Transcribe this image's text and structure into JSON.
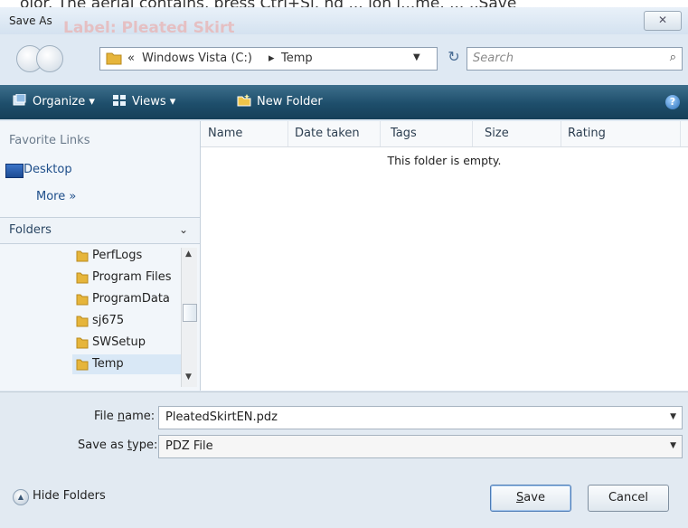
{
  "window": {
    "title": "Save As",
    "ghost_label": "Label: Pleated Skirt",
    "close_glyph": "✕"
  },
  "top_snippet": "olor. The aerial contains, press Ctrl+Sl, nd ... ion l...me. ... ,,Save",
  "nav": {
    "breadcrumb": [
      "«",
      "Windows Vista (C:)",
      "▸",
      "Temp"
    ],
    "search_placeholder": "Search",
    "refresh_glyph": "↻",
    "search_icon": "⌕"
  },
  "toolbar": {
    "organize": "Organize ▾",
    "views": "Views ▾",
    "new_folder": "New Folder",
    "help": "?"
  },
  "left_pane": {
    "favorite_links": "Favorite Links",
    "desktop": "Desktop",
    "more": "More »",
    "folders": "Folders",
    "folders_chevron": "⌄",
    "tree": [
      "PerfLogs",
      "Program Files",
      "ProgramData",
      "sj675",
      "SWSetup",
      "Temp"
    ]
  },
  "file_list": {
    "columns": [
      "Name",
      "Date taken",
      "Tags",
      "Size",
      "Rating"
    ],
    "empty_text": "This folder is empty."
  },
  "bottom": {
    "filename_label_pre": "File ",
    "filename_label_u": "n",
    "filename_label_post": "ame:",
    "filename_value": "PleatedSkirtEN.pdz",
    "type_label_pre": "Save as ",
    "type_label_u": "t",
    "type_label_post": "ype:",
    "type_value": "PDZ File",
    "hide_folders": "Hide Folders",
    "save_u": "S",
    "save_rest": "ave",
    "cancel": "Cancel"
  },
  "colors": {
    "toolbar_top": "#3d6f8c",
    "toolbar_bottom": "#163f58",
    "folder_yellow": "#e6b53b",
    "link_blue": "#1e4e8a"
  }
}
